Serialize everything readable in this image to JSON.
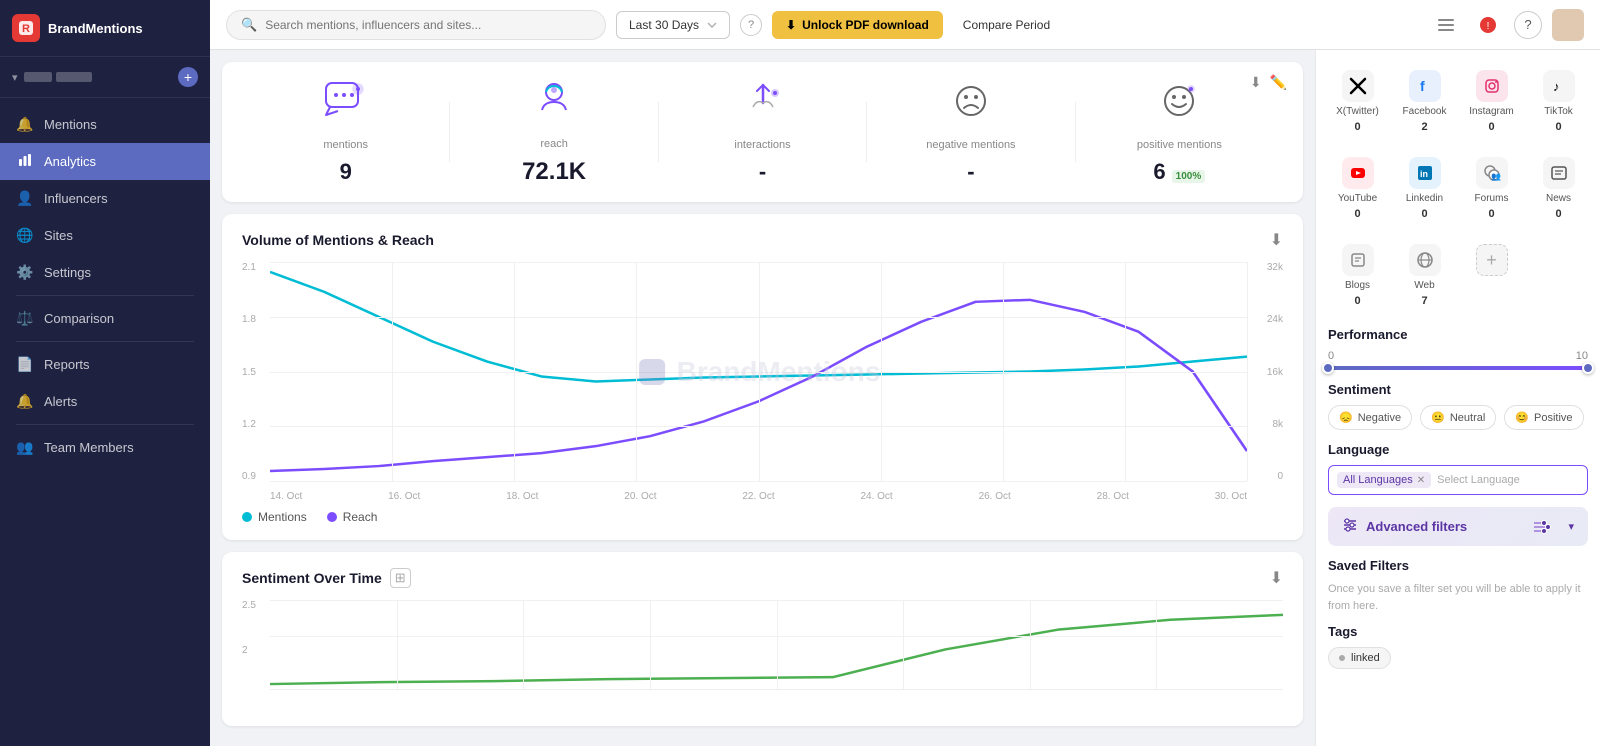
{
  "brand": {
    "name": "BrandMentions",
    "logo_letter": "R"
  },
  "sidebar": {
    "items": [
      {
        "id": "mentions",
        "label": "Mentions",
        "icon": "🔔"
      },
      {
        "id": "analytics",
        "label": "Analytics",
        "icon": "📊",
        "active": true
      },
      {
        "id": "influencers",
        "label": "Influencers",
        "icon": "👤"
      },
      {
        "id": "sites",
        "label": "Sites",
        "icon": "🌐"
      },
      {
        "id": "settings",
        "label": "Settings",
        "icon": "⚙️"
      },
      {
        "id": "comparison",
        "label": "Comparison",
        "icon": "⚖️"
      },
      {
        "id": "reports",
        "label": "Reports",
        "icon": "📄"
      },
      {
        "id": "alerts",
        "label": "Alerts",
        "icon": "🔔"
      },
      {
        "id": "team-members",
        "label": "Team Members",
        "icon": "👥"
      }
    ]
  },
  "topbar": {
    "search_placeholder": "Search mentions, influencers and sites...",
    "date_range": "Last 30 Days",
    "unlock_btn": "Unlock PDF download",
    "compare_btn": "Compare Period"
  },
  "stats": {
    "items": [
      {
        "id": "mentions",
        "label": "mentions",
        "value": "9"
      },
      {
        "id": "reach",
        "label": "reach",
        "value": "72.1K"
      },
      {
        "id": "interactions",
        "label": "interactions",
        "value": "-"
      },
      {
        "id": "negative-mentions",
        "label": "negative mentions",
        "value": "-"
      },
      {
        "id": "positive-mentions",
        "label": "positive mentions",
        "value": "6",
        "badge": "100%"
      }
    ]
  },
  "volume_chart": {
    "title": "Volume of Mentions & Reach",
    "axis_left": [
      "2.1",
      "1.8",
      "1.5",
      "1.2",
      "0.9"
    ],
    "axis_right": [
      "32k",
      "24k",
      "16k",
      "8k",
      "0"
    ],
    "axis_bottom": [
      "14. Oct",
      "16. Oct",
      "18. Oct",
      "20. Oct",
      "22. Oct",
      "24. Oct",
      "26. Oct",
      "28. Oct",
      "30. Oct"
    ],
    "legend": [
      {
        "label": "Mentions",
        "color": "#00bcd4"
      },
      {
        "label": "Reach",
        "color": "#7c4dff"
      }
    ],
    "watermark": "BrandMentions"
  },
  "sentiment_chart": {
    "title": "Sentiment Over Time",
    "axis_y": [
      "2.5",
      "2",
      ""
    ],
    "download_icon": "⬇"
  },
  "sources": {
    "items": [
      {
        "id": "x-twitter",
        "name": "X(Twitter)",
        "count": "0",
        "icon": "✕",
        "color": "#000"
      },
      {
        "id": "facebook",
        "name": "Facebook",
        "count": "2",
        "icon": "f",
        "color": "#1877f2"
      },
      {
        "id": "instagram",
        "name": "Instagram",
        "count": "0",
        "icon": "◉",
        "color": "#e1306c"
      },
      {
        "id": "tiktok",
        "name": "TikTok",
        "count": "0",
        "icon": "♪",
        "color": "#000"
      },
      {
        "id": "youtube",
        "name": "YouTube",
        "count": "0",
        "icon": "▶",
        "color": "#ff0000"
      },
      {
        "id": "linkedin",
        "name": "Linkedin",
        "count": "0",
        "icon": "in",
        "color": "#0077b5"
      },
      {
        "id": "forums",
        "name": "Forums",
        "count": "0",
        "icon": "👥",
        "color": "#888"
      },
      {
        "id": "news",
        "name": "News",
        "count": "0",
        "icon": "📰",
        "color": "#555"
      },
      {
        "id": "blogs",
        "name": "Blogs",
        "count": "0",
        "icon": "✍",
        "color": "#888"
      },
      {
        "id": "web",
        "name": "Web",
        "count": "7",
        "icon": "🌐",
        "color": "#888"
      },
      {
        "id": "add",
        "name": "",
        "count": "",
        "icon": "+",
        "color": "#888"
      }
    ]
  },
  "performance": {
    "title": "Performance",
    "min": "0",
    "max": "10"
  },
  "sentiment_filter": {
    "title": "Sentiment",
    "chips": [
      {
        "id": "negative",
        "label": "Negative",
        "icon": "😞",
        "color": "#e53935"
      },
      {
        "id": "neutral",
        "label": "Neutral",
        "icon": "😐",
        "color": "#888"
      },
      {
        "id": "positive",
        "label": "Positive",
        "icon": "😊",
        "color": "#43a047"
      }
    ]
  },
  "language": {
    "title": "Language",
    "selected": "All Languages",
    "placeholder": "Select Language"
  },
  "advanced_filters": {
    "label": "Advanced filters",
    "icon": "🎚"
  },
  "saved_filters": {
    "title": "Saved Filters",
    "description": "Once you save a filter set you will be able to apply it from here."
  },
  "tags": {
    "title": "Tags",
    "items": [
      {
        "label": "linked"
      }
    ]
  }
}
